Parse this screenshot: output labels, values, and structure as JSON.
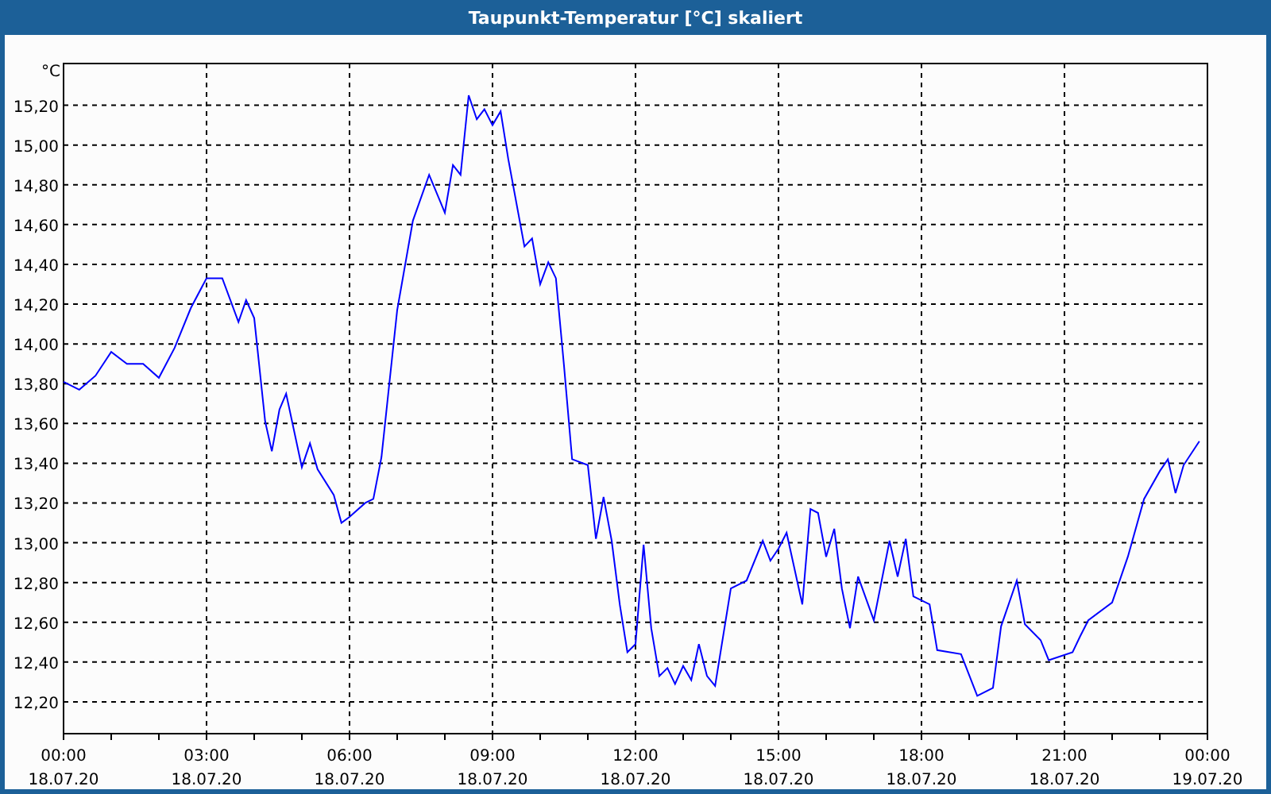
{
  "window": {
    "title": "Taupunkt-Temperatur [°C] skaliert"
  },
  "chart": {
    "chart_data": {
      "type": "line",
      "ylabel": "°C",
      "xlim": [
        0,
        24
      ],
      "ylim": [
        12.04,
        15.41
      ],
      "x": [
        0,
        0.33,
        0.67,
        1,
        1.33,
        1.67,
        2,
        2.33,
        2.67,
        3,
        3.33,
        3.67,
        3.83,
        4,
        4.23,
        4.37,
        4.53,
        4.67,
        5,
        5.17,
        5.33,
        5.67,
        5.83,
        6,
        6.33,
        6.5,
        6.67,
        7,
        7.33,
        7.67,
        8,
        8.17,
        8.33,
        8.5,
        8.67,
        8.83,
        9,
        9.17,
        9.33,
        9.67,
        9.83,
        10,
        10.17,
        10.33,
        10.5,
        10.67,
        11,
        11.17,
        11.33,
        11.5,
        11.67,
        11.83,
        12,
        12.17,
        12.33,
        12.5,
        12.67,
        12.83,
        13,
        13.17,
        13.33,
        13.5,
        13.67,
        14,
        14.33,
        14.67,
        14.83,
        15,
        15.17,
        15.5,
        15.67,
        15.83,
        16,
        16.17,
        16.33,
        16.5,
        16.67,
        17,
        17.33,
        17.5,
        17.67,
        17.83,
        18.17,
        18.33,
        18.83,
        19.17,
        19.5,
        19.67,
        20,
        20.17,
        20.5,
        20.67,
        21.17,
        21.33,
        21.5,
        22,
        22.33,
        22.67,
        23,
        23.17,
        23.33,
        23.5,
        23.83
      ],
      "series": [
        {
          "color": "#0000ff",
          "values": [
            13.81,
            13.77,
            13.84,
            13.96,
            13.9,
            13.9,
            13.83,
            13.98,
            14.18,
            14.33,
            14.33,
            14.11,
            14.22,
            14.13,
            13.61,
            13.46,
            13.67,
            13.75,
            13.38,
            13.5,
            13.37,
            13.24,
            13.1,
            13.13,
            13.2,
            13.22,
            13.43,
            14.17,
            14.62,
            14.85,
            14.66,
            14.9,
            14.85,
            15.25,
            15.13,
            15.18,
            15.1,
            15.17,
            14.93,
            14.49,
            14.53,
            14.3,
            14.41,
            14.33,
            13.89,
            13.42,
            13.39,
            13.02,
            13.23,
            13.01,
            12.69,
            12.45,
            12.49,
            12.99,
            12.57,
            12.33,
            12.37,
            12.29,
            12.38,
            12.31,
            12.49,
            12.33,
            12.28,
            12.77,
            12.81,
            13.01,
            12.91,
            12.97,
            13.05,
            12.69,
            13.17,
            13.15,
            12.93,
            13.07,
            12.77,
            12.57,
            12.83,
            12.61,
            13.01,
            12.83,
            13.02,
            12.73,
            12.69,
            12.46,
            12.44,
            12.23,
            12.27,
            12.58,
            12.81,
            12.59,
            12.51,
            12.41,
            12.45,
            12.53,
            12.61,
            12.7,
            12.93,
            13.22,
            13.36,
            13.42,
            13.25,
            13.39,
            13.51
          ]
        }
      ],
      "yticks": [
        {
          "value": 12.2,
          "label": "12,20"
        },
        {
          "value": 12.4,
          "label": "12,40"
        },
        {
          "value": 12.6,
          "label": "12,60"
        },
        {
          "value": 12.8,
          "label": "12,80"
        },
        {
          "value": 13.0,
          "label": "13,00"
        },
        {
          "value": 13.2,
          "label": "13,20"
        },
        {
          "value": 13.4,
          "label": "13,40"
        },
        {
          "value": 13.6,
          "label": "13,60"
        },
        {
          "value": 13.8,
          "label": "13,80"
        },
        {
          "value": 14.0,
          "label": "14,00"
        },
        {
          "value": 14.2,
          "label": "14,20"
        },
        {
          "value": 14.4,
          "label": "14,40"
        },
        {
          "value": 14.6,
          "label": "14,60"
        },
        {
          "value": 14.8,
          "label": "14,80"
        },
        {
          "value": 15.0,
          "label": "15,00"
        },
        {
          "value": 15.2,
          "label": "15,20"
        }
      ],
      "xticks": [
        {
          "value": 0,
          "label": "00:00"
        },
        {
          "value": 3,
          "label": "03:00"
        },
        {
          "value": 6,
          "label": "06:00"
        },
        {
          "value": 9,
          "label": "09:00"
        },
        {
          "value": 12,
          "label": "12:00"
        },
        {
          "value": 15,
          "label": "15:00"
        },
        {
          "value": 18,
          "label": "18:00"
        },
        {
          "value": 21,
          "label": "21:00"
        },
        {
          "value": 24,
          "label": "00:00"
        }
      ],
      "grid": true
    },
    "x_tick_dates": [
      "18.07.20",
      "18.07.20",
      "18.07.20",
      "18.07.20",
      "18.07.20",
      "18.07.20",
      "18.07.20",
      "18.07.20",
      "19.07.20"
    ]
  }
}
